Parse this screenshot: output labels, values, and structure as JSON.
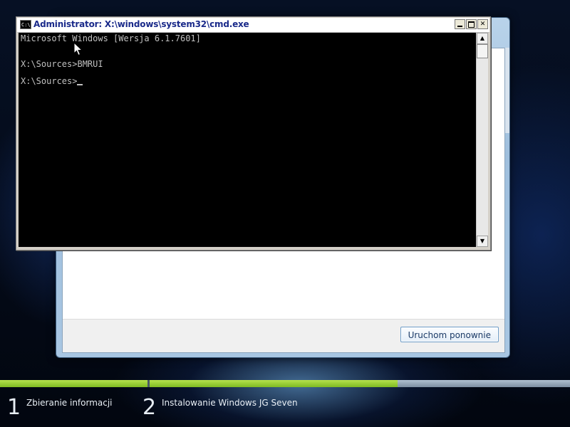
{
  "cmd": {
    "title": "Administrator: X:\\windows\\system32\\cmd.exe",
    "icon_text": "C:\\",
    "lines": [
      "Microsoft Windows [Wersja 6.1.7601]",
      "",
      "X:\\Sources>BMRUI",
      "",
      "X:\\Sources>"
    ],
    "buttons": {
      "minimize": "minimize-icon",
      "maximize": "maximize-icon",
      "close": "close-icon"
    }
  },
  "setup": {
    "restart_button": "Uruchom ponownie"
  },
  "progress": {
    "steps": [
      {
        "num": "1",
        "label": "Zbieranie informacji"
      },
      {
        "num": "2",
        "label": "Instalowanie Windows JG Seven"
      }
    ]
  },
  "colors": {
    "progress_green": "#8ec63f",
    "console_bg": "#000000",
    "console_text": "#c0c0c0",
    "title_text": "#1a2a8a"
  }
}
